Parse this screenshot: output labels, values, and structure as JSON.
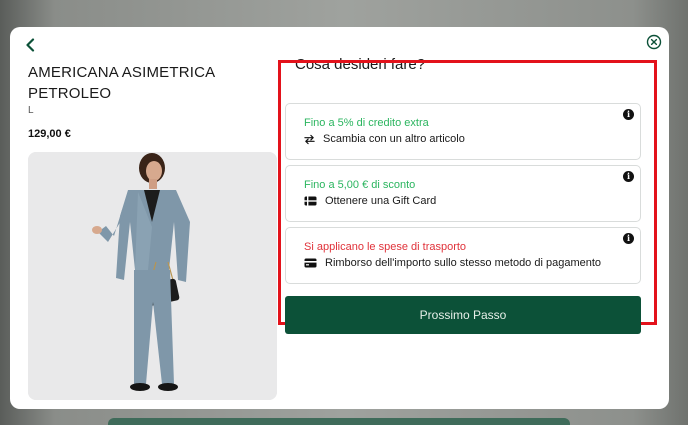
{
  "modal": {
    "back_icon": "chevron-left-icon",
    "close_icon": "close-circle-icon"
  },
  "product": {
    "title": "AMERICANA ASIMETRICA PETROLEO",
    "size": "L",
    "price": "129,00 €"
  },
  "actions": {
    "heading": "Cosa desideri fare?",
    "options": [
      {
        "tag": "Fino a 5% di credito extra",
        "tag_color": "#2bb55f",
        "label": "Scambia con un altro articolo",
        "icon": "swap-arrows-icon"
      },
      {
        "tag": "Fino a 5,00 € di sconto",
        "tag_color": "#2bb55f",
        "label": "Ottenere una Gift Card",
        "icon": "gift-card-icon"
      },
      {
        "tag": "Si applicano le spese di trasporto",
        "tag_color": "#e0323a",
        "label": "Rimborso dell'importo sullo stesso metodo di pagamento",
        "icon": "credit-card-icon"
      }
    ],
    "next_label": "Prossimo Passo"
  },
  "colors": {
    "accent": "#0c5138",
    "highlight": "#e3121b"
  }
}
